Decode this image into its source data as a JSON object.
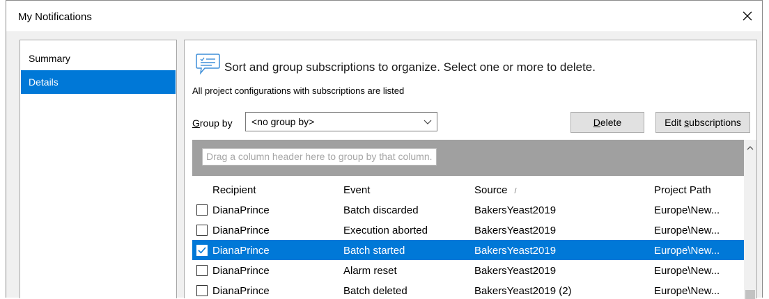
{
  "window": {
    "title": "My Notifications"
  },
  "nav": {
    "items": [
      {
        "label": "Summary",
        "selected": false
      },
      {
        "label": "Details",
        "selected": true
      }
    ]
  },
  "panel": {
    "headline": "Sort and group subscriptions to organize. Select one or more to delete.",
    "subline": "All project configurations with subscriptions are listed",
    "group_by": {
      "label_access": "G",
      "label_rest": "roup by",
      "value": "<no group by>"
    },
    "buttons": {
      "delete_access": "D",
      "delete_rest": "elete",
      "edit_pre": "Edit ",
      "edit_access": "s",
      "edit_rest": "ubscriptions"
    }
  },
  "grid": {
    "group_hint": "Drag a column header here to group by that column.",
    "columns": [
      "Recipient",
      "Event",
      "Source",
      "Project Path"
    ],
    "sort_indicator": "/",
    "rows": [
      {
        "checked": false,
        "selected": false,
        "recipient": "DianaPrince",
        "event": "Batch discarded",
        "source": "BakersYeast2019",
        "path": "Europe\\New..."
      },
      {
        "checked": false,
        "selected": false,
        "recipient": "DianaPrince",
        "event": "Execution aborted",
        "source": "BakersYeast2019",
        "path": "Europe\\New..."
      },
      {
        "checked": true,
        "selected": true,
        "recipient": "DianaPrince",
        "event": "Batch started",
        "source": "BakersYeast2019",
        "path": "Europe\\New..."
      },
      {
        "checked": false,
        "selected": false,
        "recipient": "DianaPrince",
        "event": "Alarm reset",
        "source": "BakersYeast2019",
        "path": "Europe\\New..."
      },
      {
        "checked": false,
        "selected": false,
        "recipient": "DianaPrince",
        "event": "Batch deleted",
        "source": "BakersYeast2019 (2)",
        "path": "Europe\\New..."
      }
    ]
  },
  "colors": {
    "accent": "#0078d7",
    "group_area": "#a0a0a0"
  },
  "icons": {
    "close": "close-icon",
    "hint": "speech-bubble-checklist-icon",
    "dropdown": "chevron-down-icon",
    "scroll_up": "chevron-up-icon",
    "check": "checkmark-icon"
  }
}
